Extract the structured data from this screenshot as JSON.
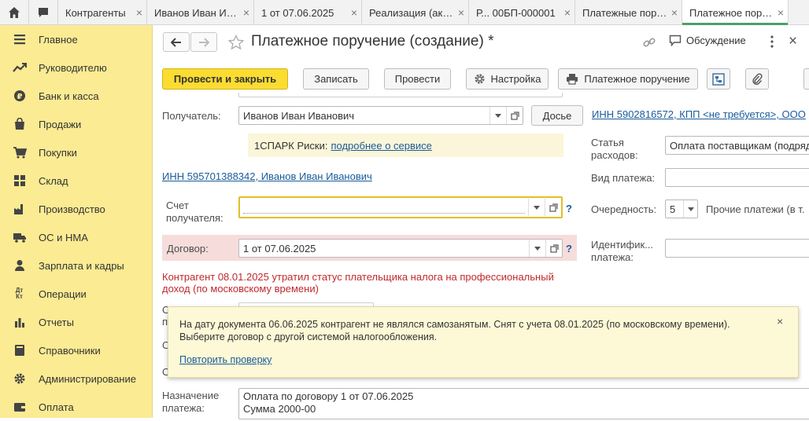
{
  "tabs": [
    {
      "label": "Контрагенты"
    },
    {
      "label": "Иванов Иван Иванович"
    },
    {
      "label": "1 от 07.06.2025"
    },
    {
      "label": "Реализация (акт, накладная)"
    },
    {
      "label": "Р... 00БП-000001"
    },
    {
      "label": "Платежные поручения"
    },
    {
      "label": "Платежное поручение"
    }
  ],
  "sidebar": {
    "items": [
      {
        "label": "Главное",
        "icon": "menu-icon"
      },
      {
        "label": "Руководителю",
        "icon": "trend-icon"
      },
      {
        "label": "Банк и касса",
        "icon": "coin-icon"
      },
      {
        "label": "Продажи",
        "icon": "bag-icon"
      },
      {
        "label": "Покупки",
        "icon": "cart-icon"
      },
      {
        "label": "Склад",
        "icon": "warehouse-icon"
      },
      {
        "label": "Производство",
        "icon": "factory-icon"
      },
      {
        "label": "ОС и НМА",
        "icon": "truck-icon"
      },
      {
        "label": "Зарплата и кадры",
        "icon": "people-icon"
      },
      {
        "label": "Операции",
        "icon": "dt-kt-icon"
      },
      {
        "label": "Отчеты",
        "icon": "bar-chart-icon"
      },
      {
        "label": "Справочники",
        "icon": "book-icon"
      },
      {
        "label": "Администрирование",
        "icon": "gear-icon"
      },
      {
        "label": "Оплата",
        "icon": "wallet-icon"
      }
    ],
    "dt_kt": "Дт Кт"
  },
  "header": {
    "title": "Платежное поручение (создание) *",
    "discussion": "Обсуждение"
  },
  "toolbar": {
    "post_close": "Провести и закрыть",
    "save": "Записать",
    "post": "Провести",
    "settings": "Настройка",
    "print_order": "Платежное поручение"
  },
  "form": {
    "recipient_label": "Получатель:",
    "recipient_value": "Иванов Иван Иванович",
    "dossier_button": "Досье",
    "inn_kpp_link": "ИНН 5902816572, КПП <не требуется>, ООО",
    "spark_text": "1СПАРК Риски:",
    "spark_link": "подробнее о сервисе",
    "recipient_inn_link": "ИНН 595701388342, Иванов Иван Иванович",
    "account_label_1": "Счет",
    "account_label_2": "получателя:",
    "account_value": "",
    "contract_label": "Договор:",
    "contract_value": "1 от 07.06.2025",
    "warning": "Контрагент 08.01.2025 утратил статус плательщика налога на профессиональный доход (по московскому времени)",
    "expense_label_1": "Статья",
    "expense_label_2": "расходов:",
    "expense_value": "Оплата поставщикам (подряд",
    "payment_type_label": "Вид платежа:",
    "payment_type_value": "",
    "priority_label": "Очередность:",
    "priority_value": "5",
    "priority_note": "Прочие платежи (в т.",
    "ident_label_1": "Идентифик...",
    "ident_label_2": "платежа:",
    "ident_value": "",
    "purpose_label_1": "Назначение",
    "purpose_label_2": "платежа:",
    "purpose_line_1": "Оплата по договору 1 от 07.06.2025",
    "purpose_line_2": "Сумма 2000-00",
    "partial_label_a": "О",
    "partial_label_b": "п",
    "partial_label_c": "О",
    "partial_label_d": "О",
    "help_mark": "?"
  },
  "popup": {
    "line1": "На дату документа 06.06.2025 контрагент не являлся самозанятым. Снят с учета 08.01.2025 (по московскому времени).",
    "line2": "Выберите договор с другой системой налогообложения.",
    "retry_link": "Повторить проверку",
    "close": "×"
  },
  "colors": {
    "sidebar_bg": "#fbeb93",
    "primary_btn": "#fbdc31",
    "link": "#1a5b9a",
    "warning_text": "#c0282d",
    "contract_highlight": "#f7dcdc",
    "spark_bg": "#fbf6d9",
    "popup_bg": "#fdf9d6",
    "active_tab_accent": "#4aa06c"
  }
}
